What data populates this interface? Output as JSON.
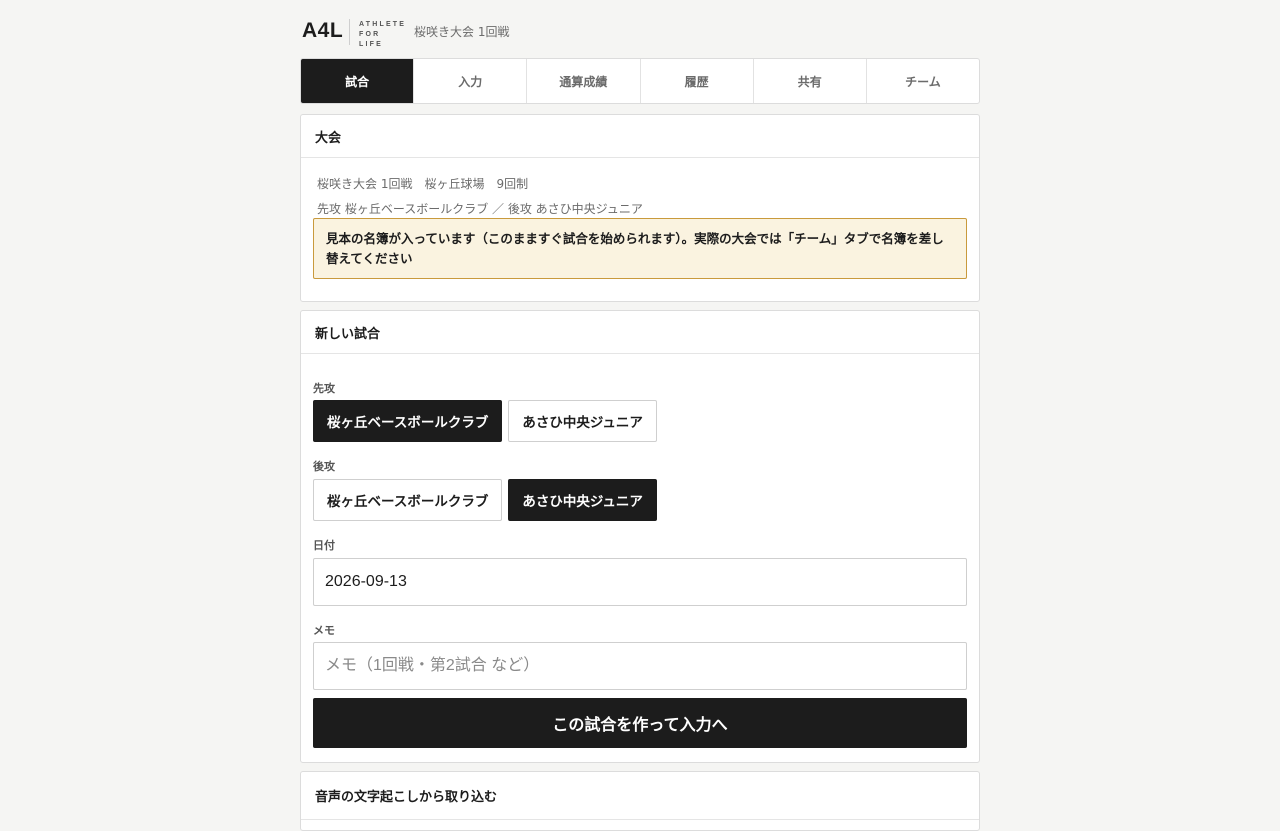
{
  "header": {
    "logo": "A4L",
    "tagline": [
      "ATHLETE",
      "FOR",
      "LIFE"
    ],
    "subtitle": "桜咲き大会 1回戦"
  },
  "tabs": [
    {
      "label": "試合",
      "active": true
    },
    {
      "label": "入力",
      "active": false
    },
    {
      "label": "通算成績",
      "active": false
    },
    {
      "label": "履歴",
      "active": false
    },
    {
      "label": "共有",
      "active": false
    },
    {
      "label": "チーム",
      "active": false
    }
  ],
  "tournament": {
    "heading": "大会",
    "info_line": "桜咲き大会 1回戦　桜ヶ丘球場　9回制",
    "teams_line": "先攻 桜ヶ丘ベースボールクラブ ／ 後攻 あさひ中央ジュニア",
    "notice": "見本の名簿が入っています（このまますぐ試合を始められます）。実際の大会では「チーム」タブで名簿を差し替えてください"
  },
  "new_game": {
    "heading": "新しい試合",
    "first_label": "先攻",
    "first_options": [
      "桜ヶ丘ベースボールクラブ",
      "あさひ中央ジュニア"
    ],
    "first_selected": "桜ヶ丘ベースボールクラブ",
    "second_label": "後攻",
    "second_options": [
      "桜ヶ丘ベースボールクラブ",
      "あさひ中央ジュニア"
    ],
    "second_selected": "あさひ中央ジュニア",
    "date_label": "日付",
    "date_value": "2026-09-13",
    "memo_label": "メモ",
    "memo_value": "",
    "memo_placeholder": "メモ（1回戦・第2試合 など）",
    "submit_label": "この試合を作って入力へ"
  },
  "voice": {
    "heading": "音声の文字起こしから取り込む"
  },
  "colors": {
    "dark": "#1c1c1c",
    "notice_bg": "#faf3e0",
    "notice_border": "#c99a3c",
    "page_bg": "#f5f5f3"
  }
}
